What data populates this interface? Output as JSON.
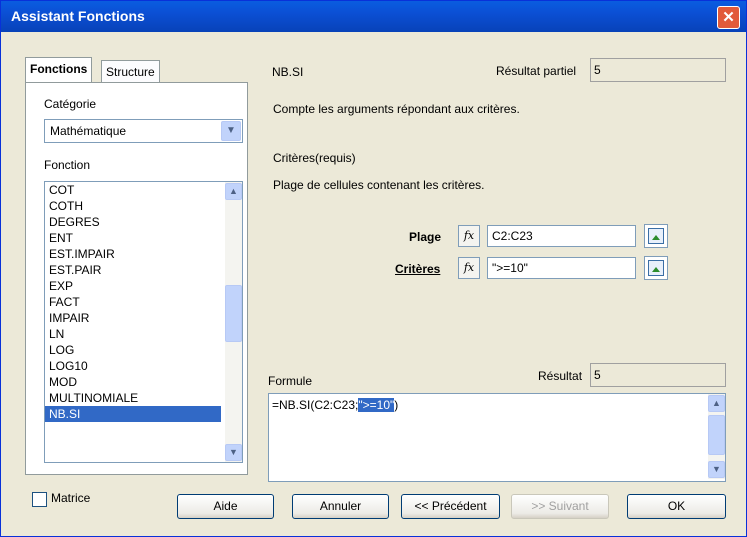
{
  "window": {
    "title": "Assistant Fonctions",
    "close_glyph": "✕"
  },
  "tabs": [
    {
      "label": "Fonctions",
      "active": true
    },
    {
      "label": "Structure",
      "active": false
    }
  ],
  "category": {
    "label": "Catégorie",
    "value": "Mathématique"
  },
  "function_list": {
    "label": "Fonction",
    "items": [
      "COT",
      "COTH",
      "DEGRES",
      "ENT",
      "EST.IMPAIR",
      "EST.PAIR",
      "EXP",
      "FACT",
      "IMPAIR",
      "LN",
      "LOG",
      "LOG10",
      "MOD",
      "MULTINOMIALE",
      "NB.SI"
    ],
    "selected": "NB.SI"
  },
  "function_info": {
    "name": "NB.SI",
    "partial_result_label": "Résultat partiel",
    "partial_result_value": "5",
    "description": "Compte les arguments répondant aux critères.",
    "arg_title": "Critères(requis)",
    "arg_description": "Plage de cellules contenant les critères."
  },
  "args": [
    {
      "label": "Plage",
      "value": "C2:C23"
    },
    {
      "label": "Critères",
      "value": "\">=10\""
    }
  ],
  "fx_glyph": "fx",
  "formula": {
    "label": "Formule",
    "result_label": "Résultat",
    "result_value": "5",
    "text_prefix": "=NB.SI(C2:C23;",
    "text_highlight": "\">=10\"",
    "text_suffix": ")"
  },
  "matrix_checkbox": {
    "label": "Matrice",
    "checked": false
  },
  "buttons": {
    "help": "Aide",
    "cancel": "Annuler",
    "previous": "<< Précédent",
    "next": ">> Suivant",
    "ok": "OK"
  },
  "icons": {
    "combo_arrow": "chevron-down-icon",
    "scroll_up": "arrow-up-icon",
    "scroll_down": "arrow-down-icon",
    "pick": "shrink-pick-icon"
  }
}
